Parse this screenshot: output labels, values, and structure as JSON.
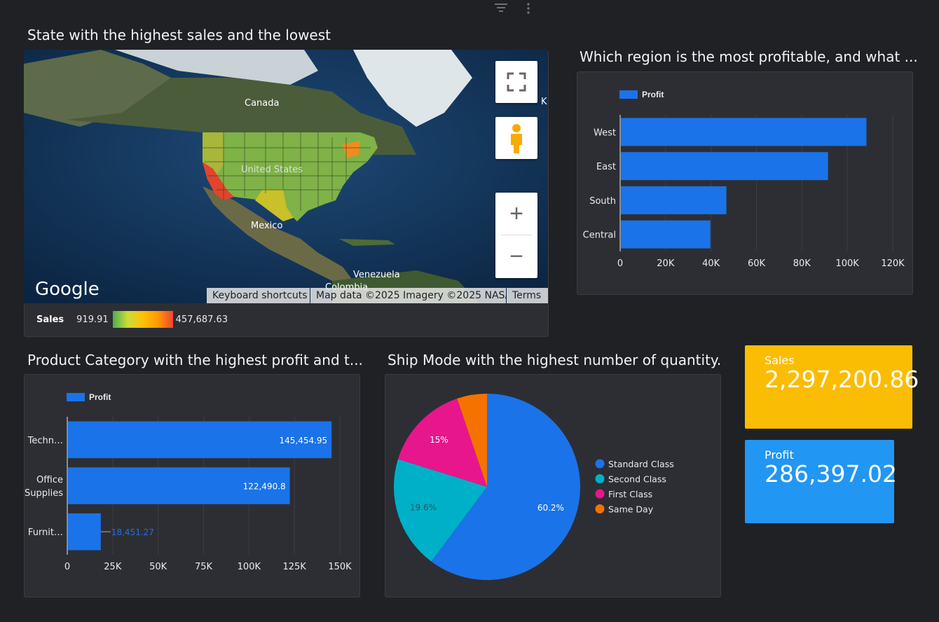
{
  "colors": {
    "bar": "#1a73e8",
    "sales_card": "#fbbc04",
    "profit_card": "#2196f3",
    "standard": "#1a73e8",
    "second": "#00b0c8",
    "first": "#e8168c",
    "sameday": "#f57200"
  },
  "toolbar": {
    "filter_icon": "filter-icon",
    "more_icon": "more-vert-icon"
  },
  "map_panel": {
    "title": "State with the highest sales and the lowest",
    "labels": {
      "canada": "Canada",
      "usa": "United States",
      "mexico": "Mexico",
      "venezuela": "Venezuela",
      "colombia": "Colombia",
      "k": "K"
    },
    "google_logo": "Google",
    "attribution": {
      "shortcuts": "Keyboard shortcuts",
      "data": "Map data ©2025 Imagery ©2025 NASA",
      "terms": "Terms"
    },
    "legend": {
      "label": "Sales",
      "min": "919.91",
      "max": "457,687.63"
    },
    "controls": {
      "fullscreen": "fullscreen-icon",
      "pegman": "pegman-icon",
      "zoom_in": "+",
      "zoom_out": "−"
    }
  },
  "region_panel": {
    "title": "Which region is the most profitable, and what ...",
    "chart_data": {
      "type": "bar",
      "orientation": "horizontal",
      "categories": [
        "West",
        "East",
        "South",
        "Central"
      ],
      "series": [
        {
          "name": "Profit",
          "values": [
            108418,
            91523,
            46750,
            39706
          ]
        }
      ],
      "xlim": [
        0,
        120000
      ],
      "xticks": [
        "0",
        "20K",
        "40K",
        "60K",
        "80K",
        "100K",
        "120K"
      ],
      "legend": "top-left",
      "grid": true
    }
  },
  "category_panel": {
    "title": "Product Category with the highest profit and t...",
    "chart_data": {
      "type": "bar",
      "orientation": "horizontal",
      "categories": [
        "Techn…",
        "Office Supplies",
        "Furnit…"
      ],
      "series": [
        {
          "name": "Profit",
          "values": [
            145454.95,
            122490.8,
            18451.27
          ]
        }
      ],
      "data_labels": [
        "145,454.95",
        "122,490.8",
        "18,451.27"
      ],
      "xlim": [
        0,
        150000
      ],
      "xticks": [
        "0",
        "25K",
        "50K",
        "75K",
        "100K",
        "125K",
        "150K"
      ],
      "legend": "top-left",
      "grid": true
    }
  },
  "shipmode_panel": {
    "title": "Ship Mode with the highest number of quantity.",
    "chart_data": {
      "type": "pie",
      "categories": [
        "Standard Class",
        "Second Class",
        "First Class",
        "Same Day"
      ],
      "values": [
        60.2,
        19.6,
        15,
        5.2
      ],
      "data_labels": [
        "60.2%",
        "19.6%",
        "15%",
        ""
      ],
      "legend": "right"
    }
  },
  "scorecards": {
    "sales": {
      "label": "Sales",
      "value": "2,297,200.86"
    },
    "profit": {
      "label": "Profit",
      "value": "286,397.02"
    }
  }
}
